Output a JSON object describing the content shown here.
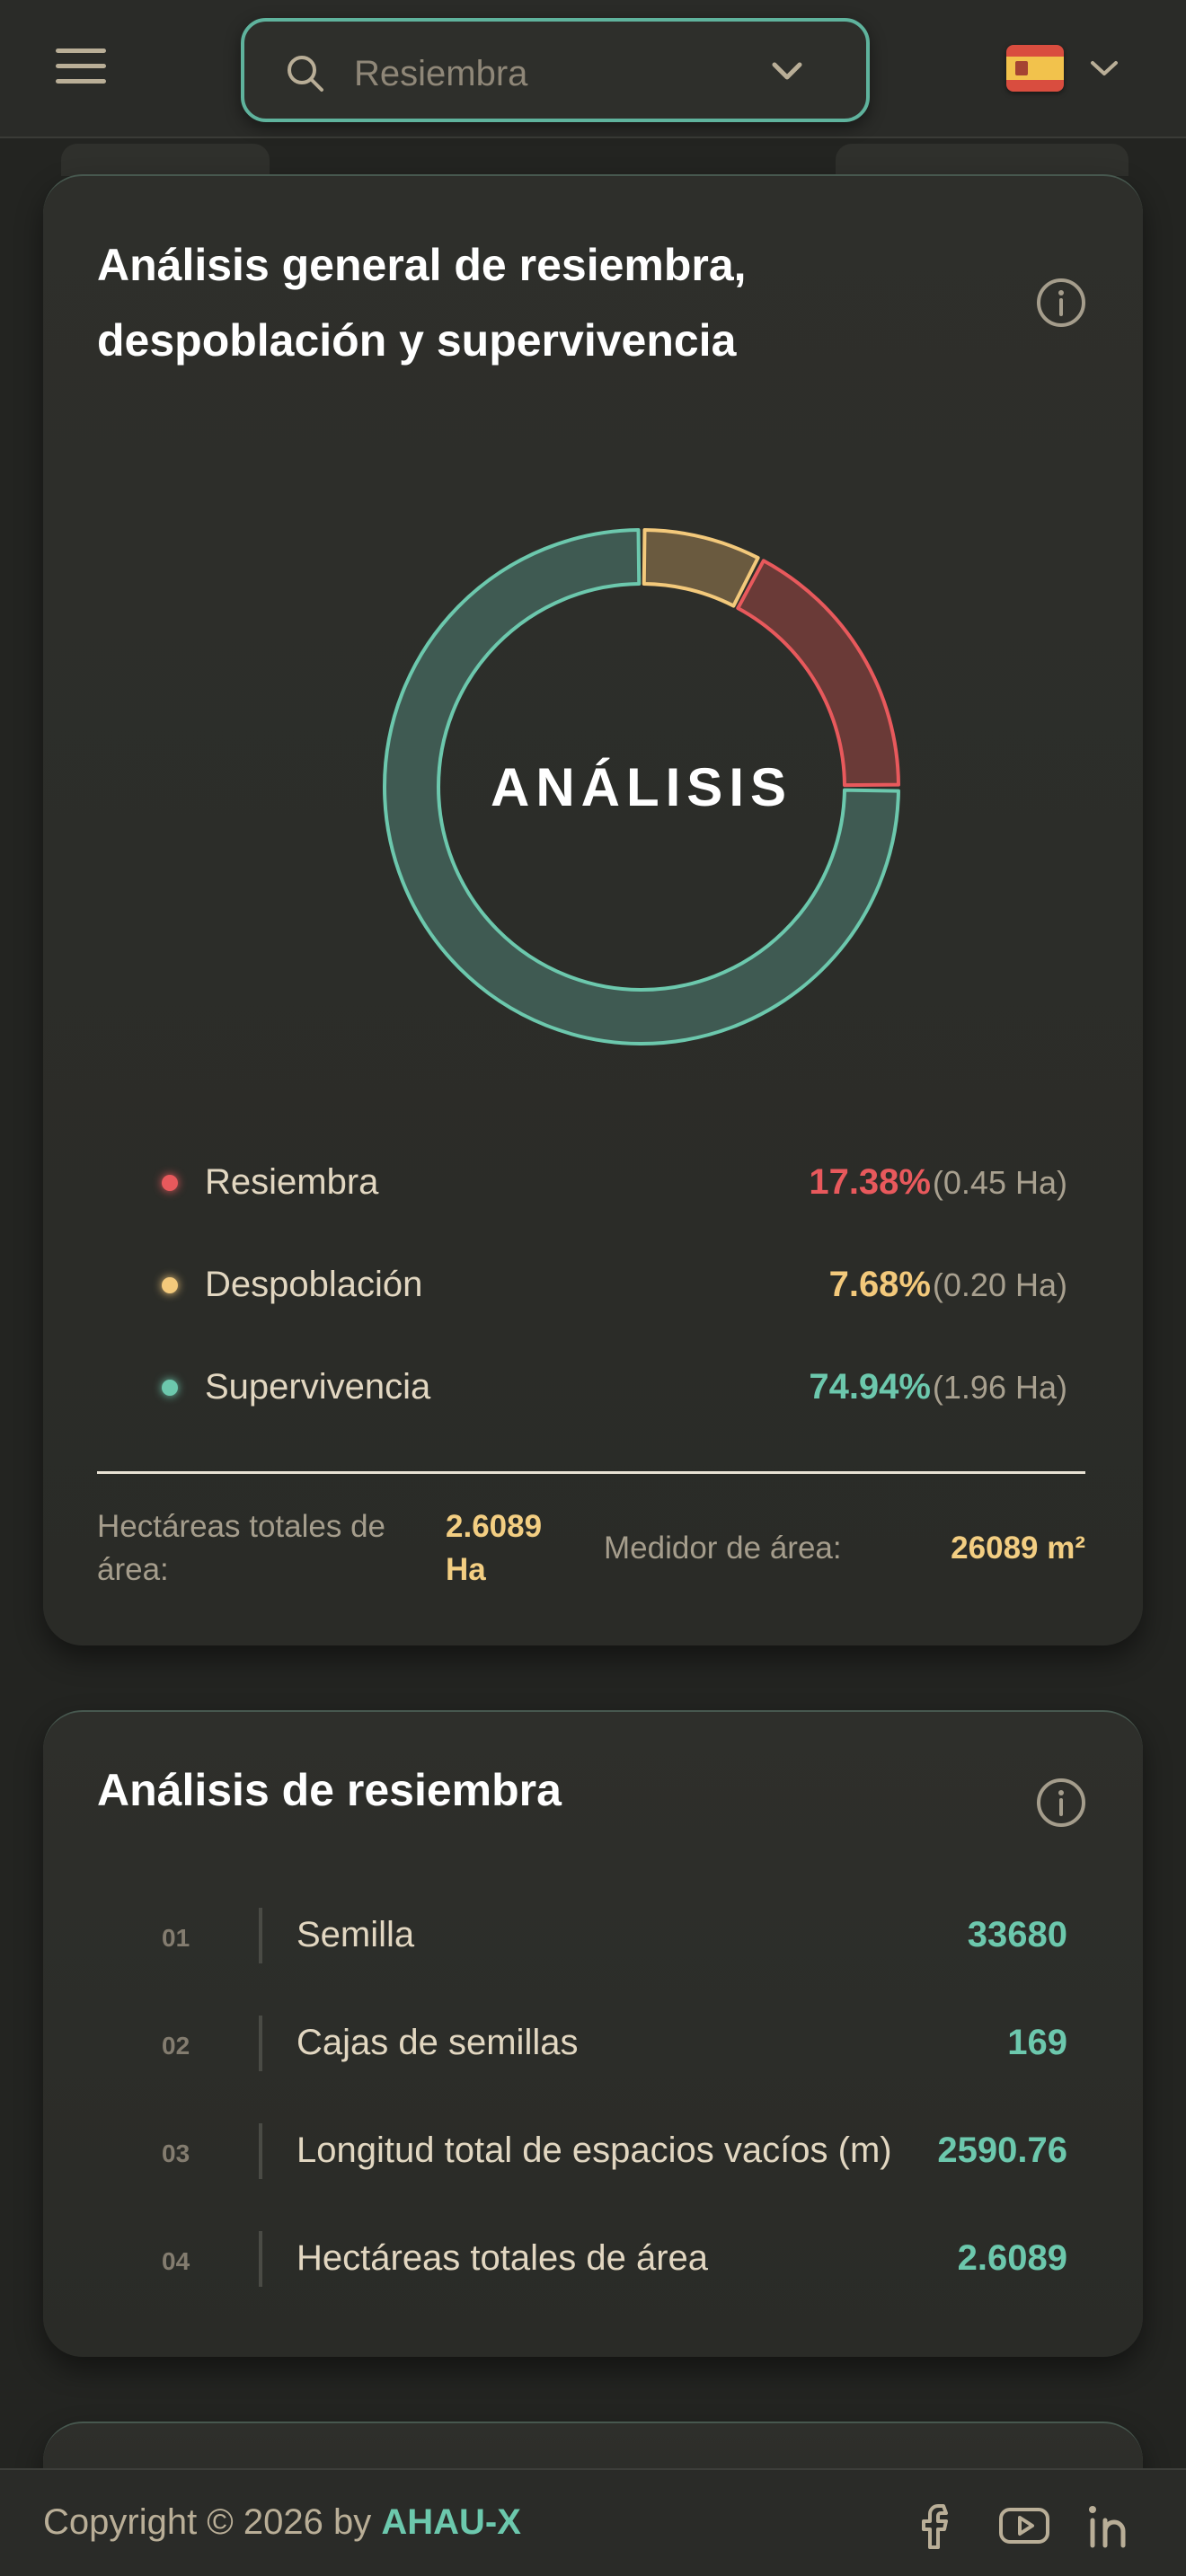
{
  "header": {
    "menu_icon": "hamburger-icon",
    "search": {
      "value": "Resiembra",
      "icon": "search-icon"
    },
    "language": {
      "flag": "spain-flag-icon"
    }
  },
  "general_card": {
    "title_line1": "Análisis general de resiembra,",
    "title_line2": "despoblación y supervivencia",
    "center_label": "ANÁLISIS",
    "legend": [
      {
        "name": "Resiembra",
        "percent": "17.38%",
        "area": "(0.45 Ha)",
        "color": "#e8595c"
      },
      {
        "name": "Despoblación",
        "percent": "7.68%",
        "area": "(0.20 Ha)",
        "color": "#f3c97b"
      },
      {
        "name": "Supervivencia",
        "percent": "74.94%",
        "area": "(1.96 Ha)",
        "color": "#6cc8ad"
      }
    ],
    "total_label": "Hectáreas totales de área:",
    "total_value_line1": "2.6089",
    "total_value_line2": "Ha",
    "meter_label": "Medidor de área:",
    "meter_value": "26089 m²"
  },
  "chart_data": {
    "type": "pie",
    "categories": [
      "Resiembra",
      "Despoblación",
      "Supervivencia"
    ],
    "values": [
      17.38,
      7.68,
      74.94
    ],
    "center_label": "ANÁLISIS"
  },
  "resiembra_card": {
    "title": "Análisis de resiembra",
    "rows": [
      {
        "num": "01",
        "label": "Semilla",
        "value": "33680"
      },
      {
        "num": "02",
        "label": "Cajas de semillas",
        "value": "169"
      },
      {
        "num": "03",
        "label": "Longitud total de espacios vacíos (m)",
        "value": "2590.76"
      },
      {
        "num": "04",
        "label": "Hectáreas totales de área",
        "value": "2.6089"
      }
    ]
  },
  "footer": {
    "copyright_prefix": "Copyright © 2026 by",
    "brand": "AHAU-X",
    "social": [
      "facebook-icon",
      "youtube-icon",
      "linkedin-icon"
    ]
  }
}
